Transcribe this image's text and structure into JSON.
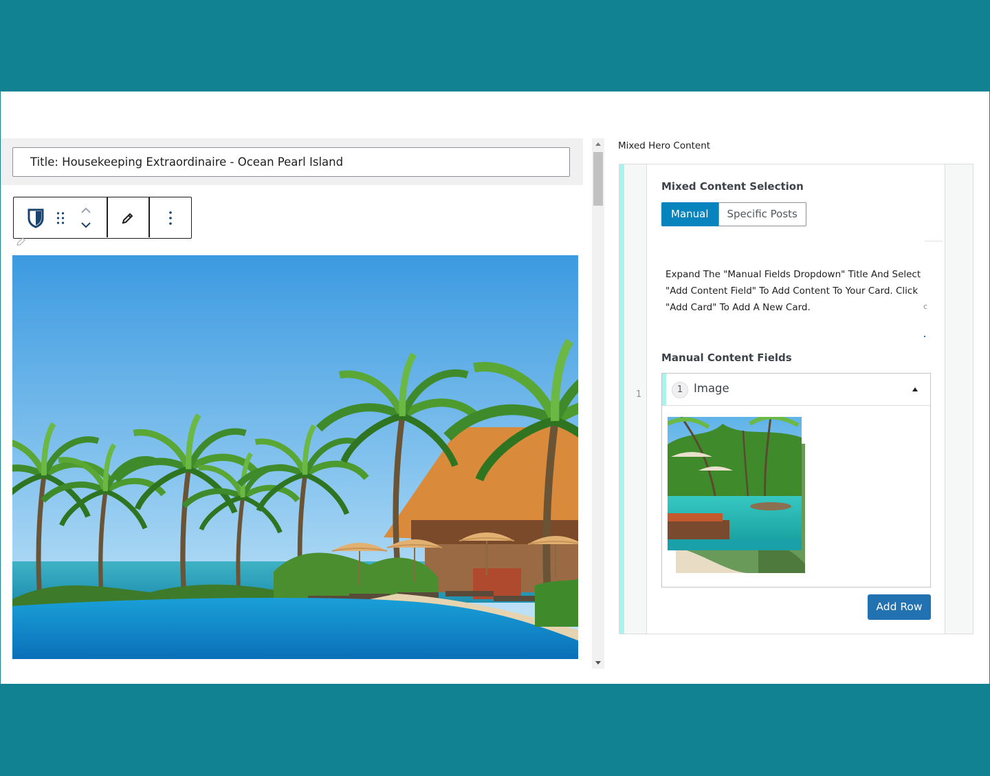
{
  "editor": {
    "title_value": "Title: Housekeeping Extraordinaire - Ocean Pearl Island",
    "toolbar": {
      "block_icon": "shield-icon",
      "drag_icon": "drag-handle-icon",
      "move_up_icon": "chevron-up-icon",
      "move_down_icon": "chevron-down-icon",
      "edit_icon": "pencil-icon",
      "options_icon": "more-vertical-icon"
    },
    "hero_image": "tropical-resort-pool-beach-palms"
  },
  "sidebar": {
    "panel_title": "Mixed Hero Content",
    "selection": {
      "label": "Mixed Content Selection",
      "options": [
        "Manual",
        "Specific Posts"
      ],
      "selected": "Manual"
    },
    "instructions": "Expand The \"Manual Fields Dropdown\" Title And Select \"Add Content Field\" To Add Content To Your Card. Click \"Add Card\" To Add A New Card.",
    "manual_fields": {
      "label": "Manual Content Fields",
      "row_index": "1",
      "item": {
        "number": "1",
        "title": "Image"
      }
    },
    "add_row_label": "Add Row",
    "stray_char": "c"
  },
  "colors": {
    "band": "#118292",
    "primary_button": "#2271b1",
    "toggle_active": "#0783be",
    "accent": "#a7f3ee"
  }
}
